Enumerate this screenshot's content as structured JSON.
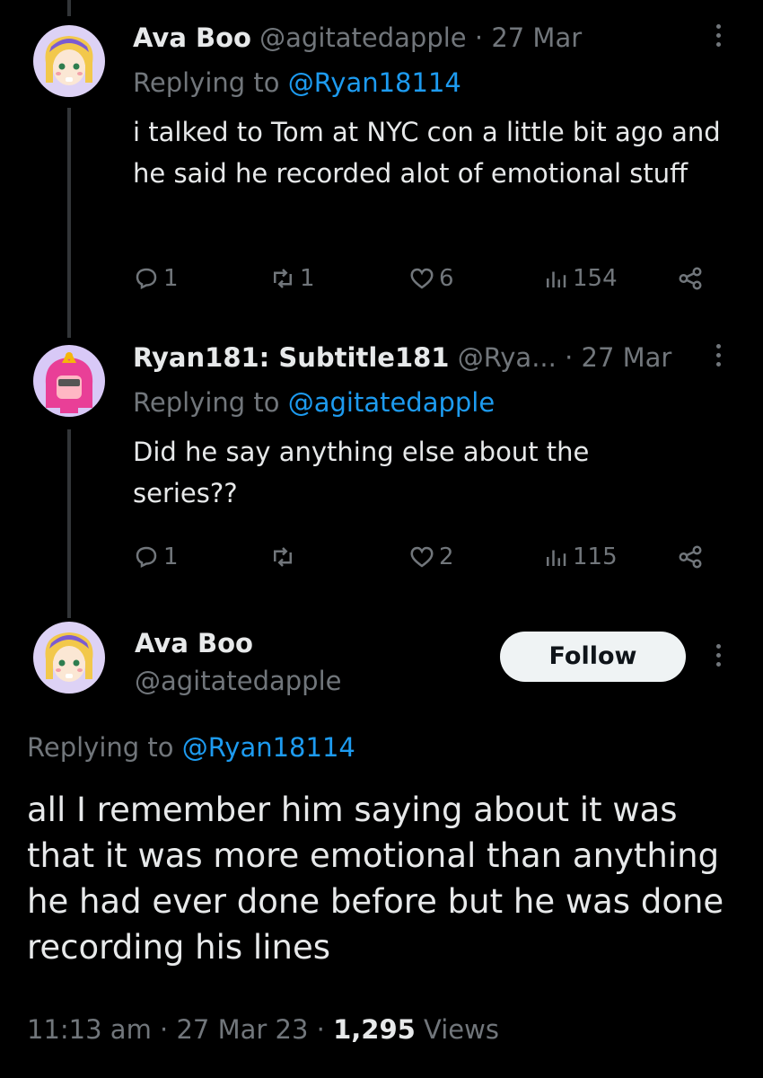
{
  "reply1": {
    "name": "Ava Boo",
    "handle": "@agitatedapple",
    "time": "27 Mar",
    "replying_prefix": "Replying to ",
    "replying_to": "@Ryan18114",
    "text": "i talked to Tom at NYC con a little bit ago and he said he recorded alot of emotional stuff",
    "replies": "1",
    "retweets": "1",
    "likes": "6",
    "views": "154"
  },
  "reply2": {
    "name": "Ryan181: Subtitle181",
    "handle": "@Rya...",
    "time": "27 Mar",
    "replying_prefix": "Replying to ",
    "replying_to": "@agitatedapple",
    "text": "Did he say anything else about the series??",
    "replies": "1",
    "retweets": "",
    "likes": "2",
    "views": "115"
  },
  "main": {
    "name": "Ava Boo",
    "handle": "@agitatedapple",
    "follow_label": "Follow",
    "replying_prefix": "Replying to ",
    "replying_to": "@Ryan18114",
    "text": "all I remember him saying about it was that it was more emotional than anything he had ever done before but he was done recording his lines",
    "time": "11:13 am",
    "date": "27 Mar 23",
    "views_count": "1,295",
    "views_label": "Views"
  },
  "separator": "·",
  "colors": {
    "accent": "#1d9bf0",
    "muted": "#71767b",
    "text": "#e7e9ea",
    "bg": "#000000"
  },
  "icons": [
    "reply-icon",
    "retweet-icon",
    "like-icon",
    "views-icon",
    "share-icon",
    "more-icon"
  ]
}
